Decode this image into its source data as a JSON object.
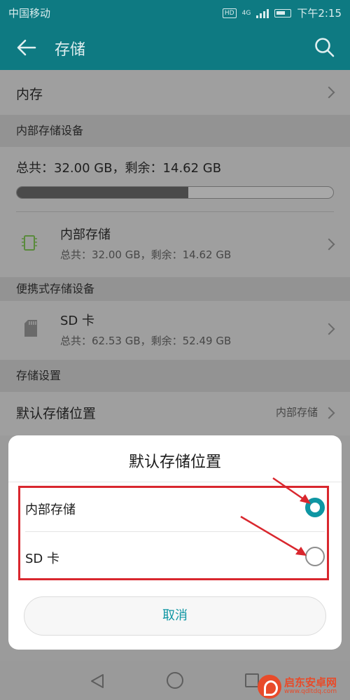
{
  "status_bar": {
    "carrier": "中国移动",
    "hd": "HD",
    "network": "4G",
    "time": "下午2:15"
  },
  "app_bar": {
    "title": "存储",
    "back_icon": "arrow-left-icon",
    "search_icon": "search-icon"
  },
  "memory_row": {
    "label": "内存"
  },
  "internal_section": {
    "header": "内部存储设备",
    "summary": "总共：32.00 GB，剩余：14.62 GB",
    "usage_fraction": 0.543,
    "item": {
      "icon": "chip-icon",
      "title": "内部存储",
      "detail": "总共：32.00 GB，剩余：14.62 GB"
    }
  },
  "portable_section": {
    "header": "便携式存储设备",
    "item": {
      "icon": "sd-card-icon",
      "title": "SD 卡",
      "detail": "总共：62.53 GB，剩余：52.49 GB"
    }
  },
  "settings_section": {
    "header": "存储设置",
    "default_location": {
      "label": "默认存储位置",
      "value": "内部存储"
    }
  },
  "dialog": {
    "title": "默认存储位置",
    "options": [
      {
        "label": "内部存储",
        "selected": true
      },
      {
        "label": "SD 卡",
        "selected": false
      }
    ],
    "cancel_label": "取消"
  },
  "watermark": {
    "name": "启东安卓网",
    "url": "www.qdltdq.com"
  },
  "colors": {
    "accent": "#0e96a3",
    "app_bar": "#0e7a82",
    "annotation_red": "#d9272e",
    "watermark": "#e84b2a"
  }
}
